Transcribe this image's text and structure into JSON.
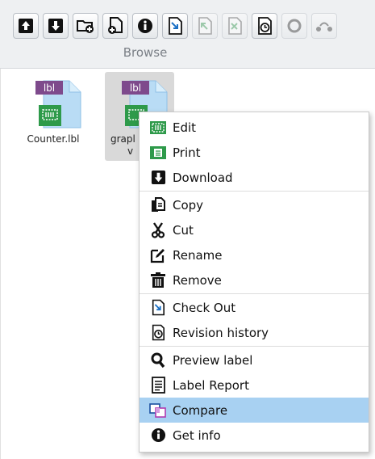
{
  "toolbar": {
    "group_label": "Browse",
    "buttons": [
      {
        "icon": "upload-icon",
        "enabled": true
      },
      {
        "icon": "download-icon",
        "enabled": true
      },
      {
        "icon": "new-folder-icon",
        "enabled": true
      },
      {
        "icon": "new-file-icon",
        "enabled": true
      },
      {
        "icon": "info-icon",
        "enabled": true
      },
      {
        "icon": "check-out-icon",
        "enabled": true
      },
      {
        "icon": "check-in-icon",
        "enabled": false
      },
      {
        "icon": "undo-check-out-icon",
        "enabled": false
      },
      {
        "icon": "history-icon",
        "enabled": true
      },
      {
        "icon": "refresh-icon",
        "enabled": false
      },
      {
        "icon": "share-icon",
        "enabled": false
      }
    ]
  },
  "files": [
    {
      "name": "Counter.lbl",
      "badge": "lbl",
      "selected": false
    },
    {
      "name": "grapl",
      "name2": "v",
      "badge": "lbl",
      "selected": true
    }
  ],
  "context_menu": {
    "items": [
      {
        "label": "Edit",
        "icon": "edit-label-icon"
      },
      {
        "label": "Print",
        "icon": "print-icon"
      },
      {
        "label": "Download",
        "icon": "download-icon"
      },
      {
        "label": "Copy",
        "icon": "copy-icon"
      },
      {
        "label": "Cut",
        "icon": "scissors-icon"
      },
      {
        "label": "Rename",
        "icon": "rename-icon"
      },
      {
        "label": "Remove",
        "icon": "trash-icon"
      },
      {
        "label": "Check Out",
        "icon": "check-out-icon"
      },
      {
        "label": "Revision history",
        "icon": "history-icon"
      },
      {
        "label": "Preview label",
        "icon": "magnifier-icon"
      },
      {
        "label": "Label Report",
        "icon": "report-icon"
      },
      {
        "label": "Compare",
        "icon": "compare-icon",
        "highlighted": true
      },
      {
        "label": "Get info",
        "icon": "info-icon"
      }
    ]
  },
  "colors": {
    "highlight": "#a8d1f2",
    "badge_purple": "#7e4a8c",
    "badge_green": "#2e9a4a",
    "doc_blue": "#b9dcf5"
  }
}
